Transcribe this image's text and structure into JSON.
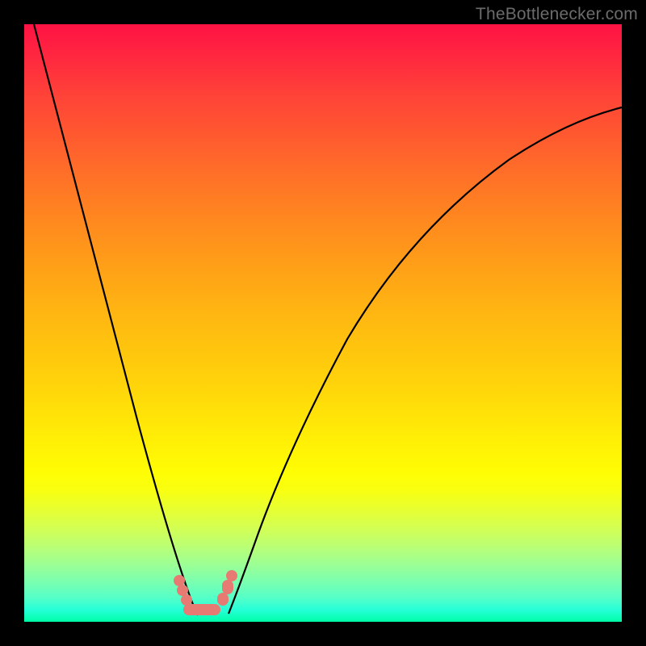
{
  "attribution": "TheBottlenecker.com",
  "chart_data": {
    "type": "line",
    "title": "",
    "xlabel": "",
    "ylabel": "",
    "xlim": [
      0,
      100
    ],
    "ylim": [
      0,
      100
    ],
    "x": [
      0,
      5,
      10,
      15,
      20,
      25,
      27.5,
      29,
      30,
      31,
      32,
      33,
      34,
      36,
      40,
      45,
      50,
      55,
      60,
      65,
      70,
      75,
      80,
      85,
      90,
      95,
      100
    ],
    "values": [
      100,
      85,
      68,
      50,
      32,
      14,
      6,
      2,
      0.5,
      0,
      0.5,
      2,
      5,
      10,
      21,
      33,
      43,
      51,
      58,
      64,
      69,
      73,
      77,
      80,
      82.5,
      84.5,
      86
    ],
    "annotations": [
      {
        "type": "valley-markers",
        "x_range": [
          28,
          35
        ],
        "shape": "U"
      }
    ],
    "background": "vertical-gradient-red-to-green"
  }
}
